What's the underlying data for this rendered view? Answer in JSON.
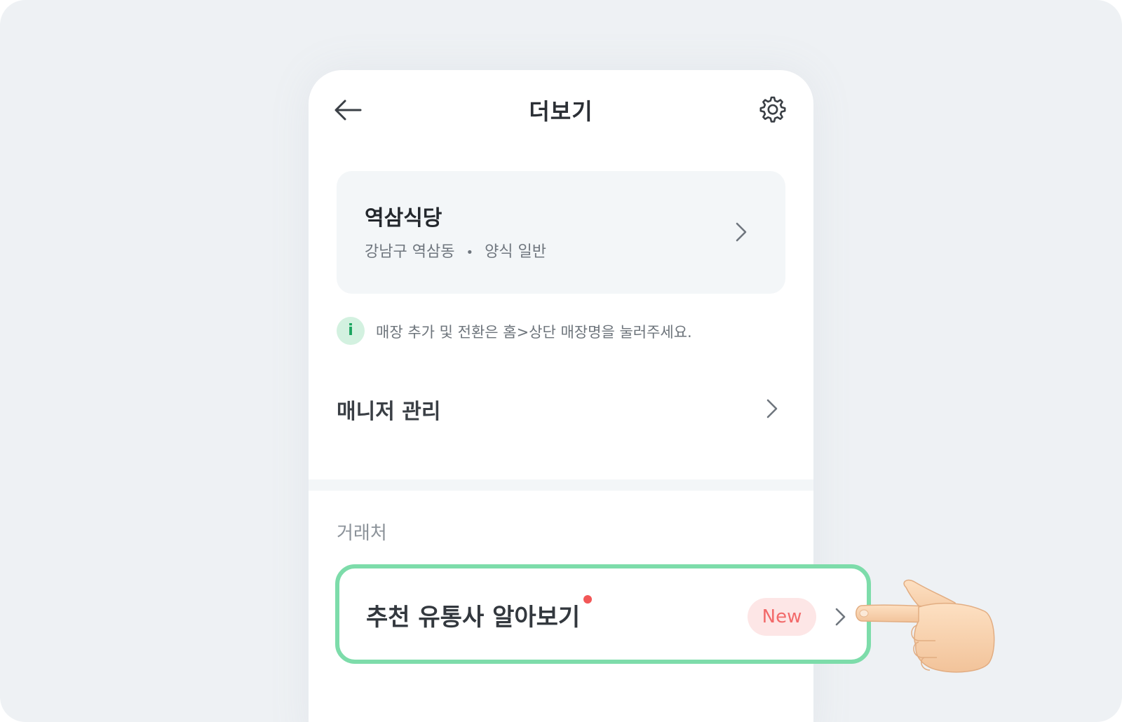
{
  "header": {
    "title": "더보기",
    "back_icon": "arrow-left-icon",
    "settings_icon": "gear-icon"
  },
  "store": {
    "name": "역삼식당",
    "location": "강남구 역삼동",
    "separator": "•",
    "category": "양식 일반",
    "chevron_icon": "chevron-right-icon"
  },
  "info": {
    "icon_text": "i",
    "message": "매장 추가 및 전환은 홈>상단 매장명을 눌러주세요."
  },
  "menu": {
    "manager_label": "매니저 관리"
  },
  "section": {
    "title": "거래처"
  },
  "recommend": {
    "label": "추천 유통사 알아보기",
    "badge": "New",
    "highlight_color": "#7ddcaa",
    "badge_color": "#f26a6a",
    "dot_color": "#f25757"
  },
  "colors": {
    "accent_green": "#1aa55f",
    "background": "#eef1f4",
    "card": "#f3f6f8"
  }
}
